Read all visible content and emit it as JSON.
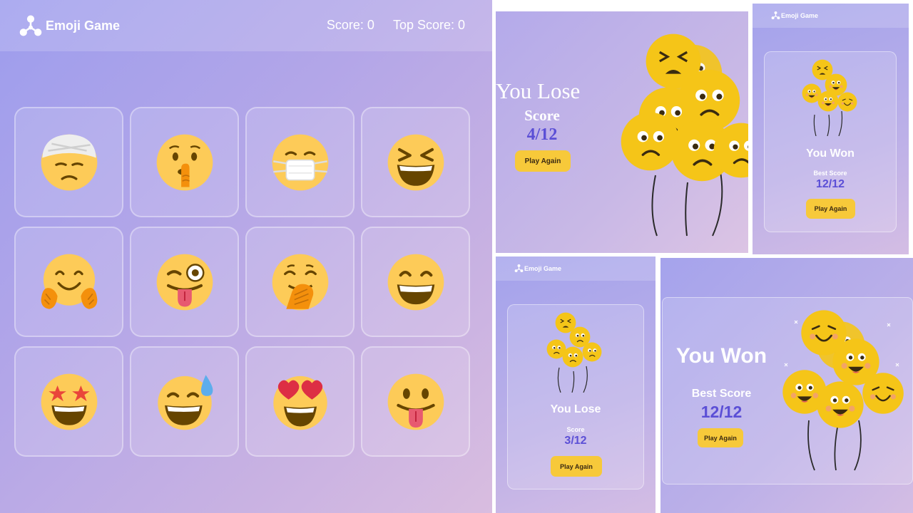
{
  "main": {
    "brand": "Emoji Game",
    "score_label": "Score: 0",
    "top_score_label": "Top Score: 0",
    "cards": [
      {
        "name": "face-with-head-bandage"
      },
      {
        "name": "shushing-face"
      },
      {
        "name": "face-with-medical-mask"
      },
      {
        "name": "grinning-squinting-face"
      },
      {
        "name": "hugging-face"
      },
      {
        "name": "winking-face-with-tongue"
      },
      {
        "name": "face-with-hand-over-mouth"
      },
      {
        "name": "beaming-face"
      },
      {
        "name": "star-struck"
      },
      {
        "name": "grinning-face-with-sweat"
      },
      {
        "name": "smiling-face-with-heart-eyes"
      },
      {
        "name": "face-with-tongue"
      }
    ]
  },
  "lose_large": {
    "title": "You Lose",
    "label": "Score",
    "score": "4/12",
    "button": "Play Again"
  },
  "won_small": {
    "brand": "Emoji Game",
    "title": "You Won",
    "label": "Best Score",
    "score": "12/12",
    "button": "Play Again"
  },
  "lose_small": {
    "brand": "Emoji Game",
    "title": "You Lose",
    "label": "Score",
    "score": "3/12",
    "button": "Play Again"
  },
  "won_large": {
    "title": "You Won",
    "label": "Best Score",
    "score": "12/12",
    "button": "Play Again"
  },
  "colors": {
    "emoji_yellow": "#fdcb58",
    "emoji_dark": "#664500",
    "score_purple": "#5b4fd6",
    "button_yellow": "#f7c93a"
  }
}
